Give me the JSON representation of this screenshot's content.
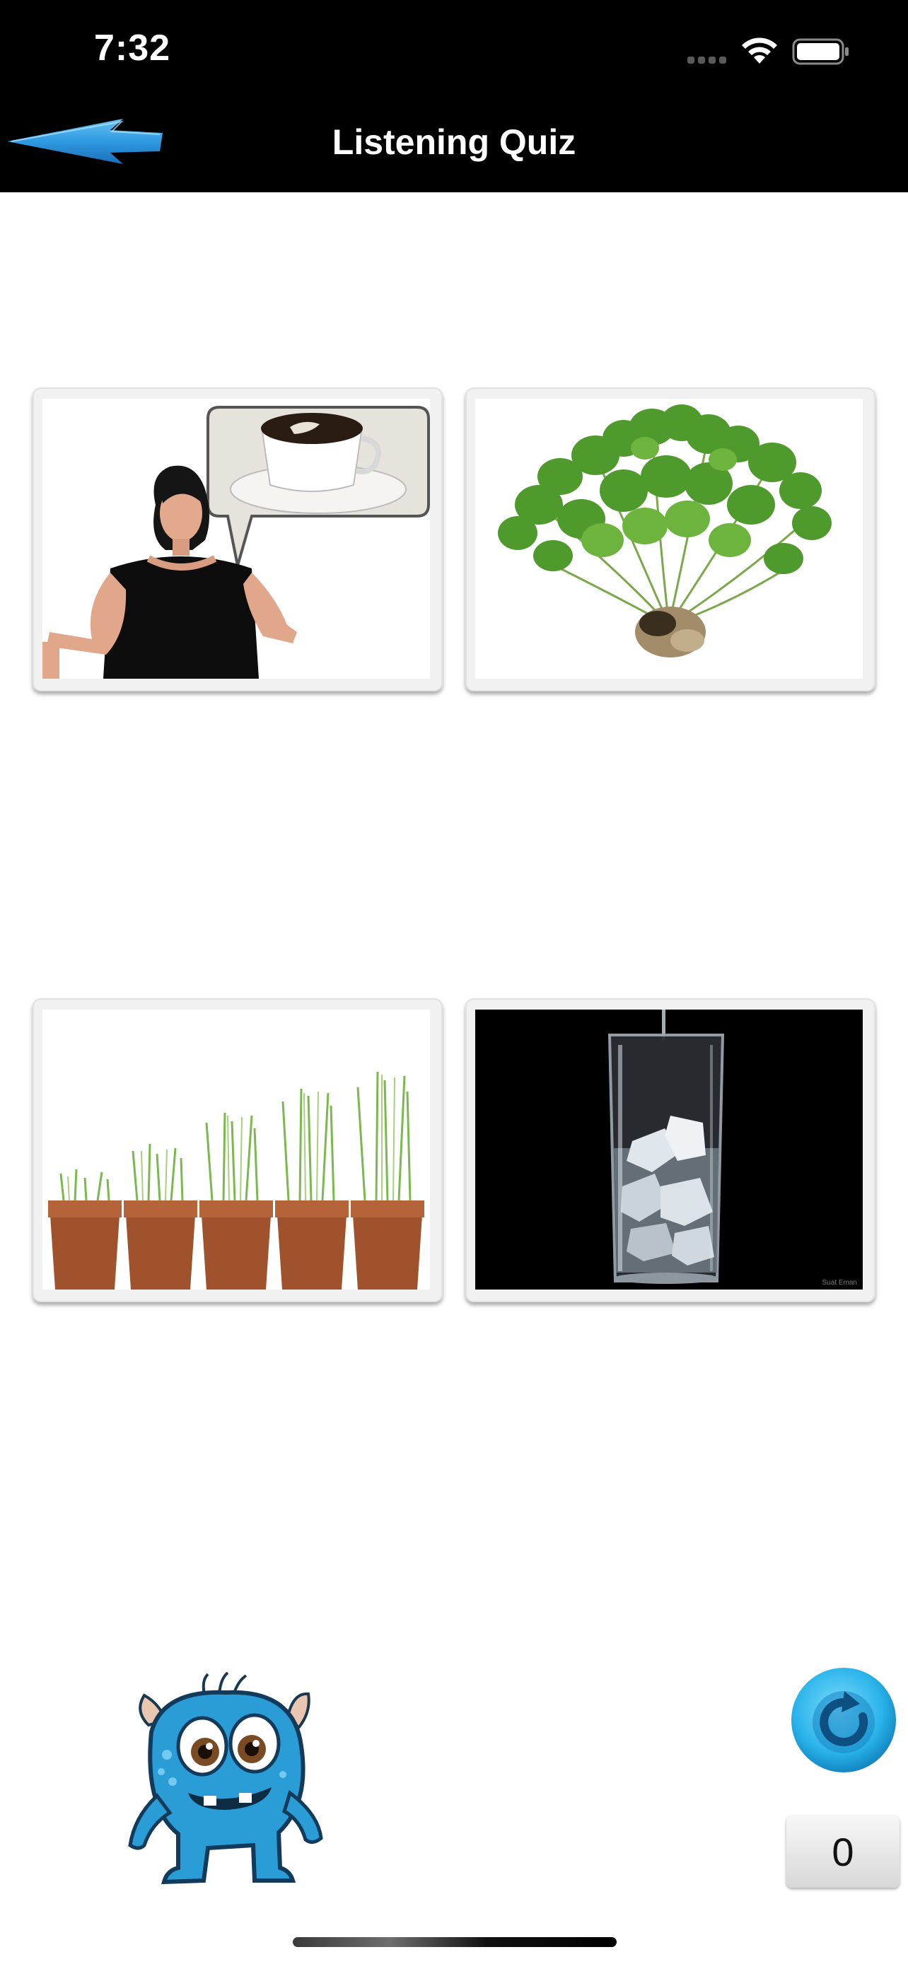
{
  "status_bar": {
    "time": "7:32"
  },
  "nav": {
    "title": "Listening Quiz",
    "back_icon": "blue-arrow-left-icon"
  },
  "answers": [
    {
      "id": "answer-1",
      "subject": "woman-pointing-to-self-thinking-of-coffee"
    },
    {
      "id": "answer-2",
      "subject": "leafy-green-plant-with-roots"
    },
    {
      "id": "answer-3",
      "subject": "grass-growing-in-five-pots"
    },
    {
      "id": "answer-4",
      "subject": "glass-of-ice-water",
      "watermark": "Suat Eman"
    }
  ],
  "controls": {
    "replay_icon": "replay-icon",
    "score": "0"
  },
  "colors": {
    "topbar": "#000000",
    "arrow_blue": "#2f9ae0",
    "replay_blue": "#2ab3ea",
    "monster_blue": "#2b9dd6"
  }
}
